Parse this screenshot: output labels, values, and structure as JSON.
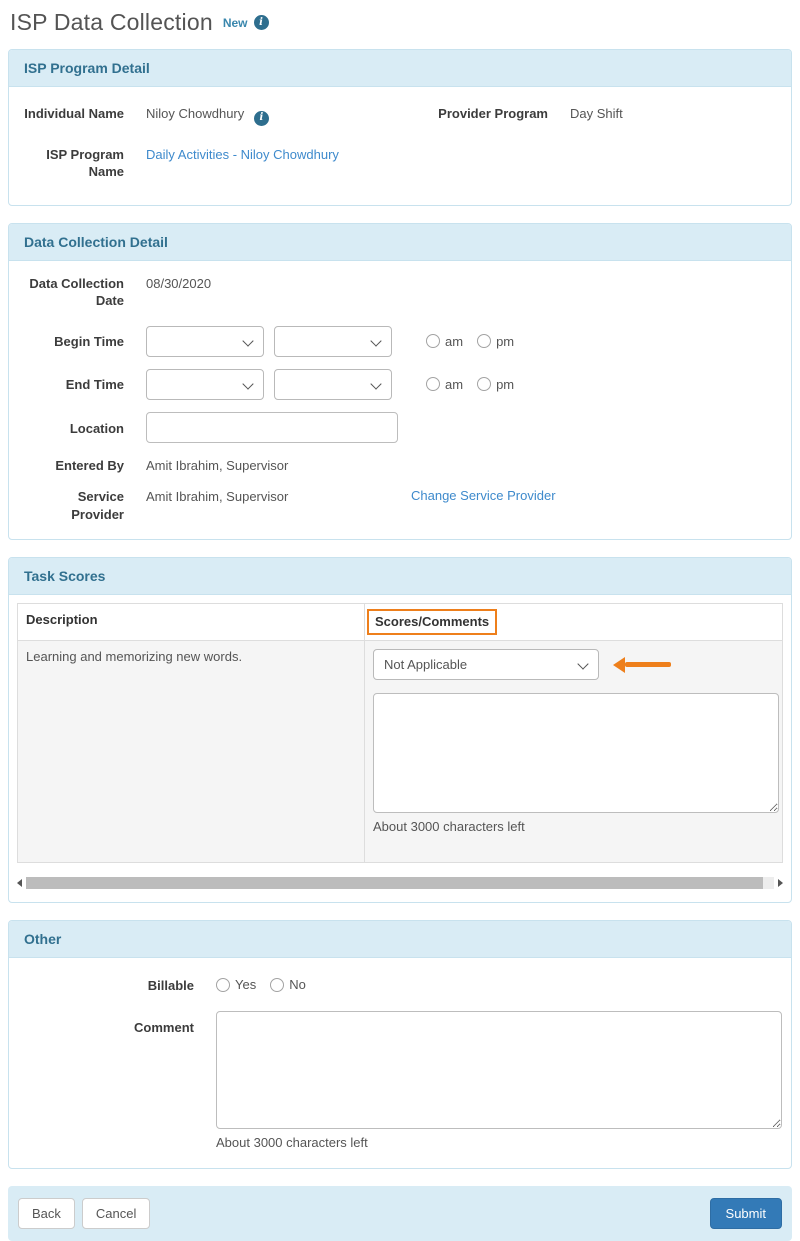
{
  "page": {
    "title": "ISP Data Collection",
    "badge": "New"
  },
  "isp_program_detail": {
    "title": "ISP Program Detail",
    "individual_name": {
      "label": "Individual Name",
      "value": "Niloy Chowdhury"
    },
    "provider_program": {
      "label": "Provider Program",
      "value": "Day Shift"
    },
    "isp_program_name": {
      "label": "ISP Program Name",
      "value": "Daily Activities - Niloy Chowdhury"
    }
  },
  "data_collection_detail": {
    "title": "Data Collection Detail",
    "date": {
      "label": "Data Collection Date",
      "value": "08/30/2020"
    },
    "begin_time": {
      "label": "Begin Time"
    },
    "end_time": {
      "label": "End Time"
    },
    "time_options": {
      "am": "am",
      "pm": "pm"
    },
    "location": {
      "label": "Location",
      "value": ""
    },
    "entered_by": {
      "label": "Entered By",
      "value": "Amit Ibrahim, Supervisor"
    },
    "service_provider": {
      "label": "Service Provider",
      "value": "Amit Ibrahim, Supervisor",
      "change_link": "Change Service Provider"
    }
  },
  "task_scores": {
    "title": "Task Scores",
    "columns": [
      "Description",
      "Scores/Comments"
    ],
    "rows": [
      {
        "description": "Learning and memorizing new words.",
        "score_value": "Not Applicable",
        "comment": "",
        "chars_hint": "About 3000 characters left"
      }
    ]
  },
  "other": {
    "title": "Other",
    "billable": {
      "label": "Billable",
      "options": [
        "Yes",
        "No"
      ]
    },
    "comment": {
      "label": "Comment",
      "value": "",
      "chars_hint": "About 3000 characters left"
    }
  },
  "footer": {
    "back": "Back",
    "cancel": "Cancel",
    "submit": "Submit"
  },
  "colors": {
    "panel_header_bg": "#d9ecf5",
    "panel_header_text": "#31708f",
    "link_blue": "#3e8acc",
    "submit_blue": "#337ab7",
    "callout_orange": "#ee7f1b"
  }
}
